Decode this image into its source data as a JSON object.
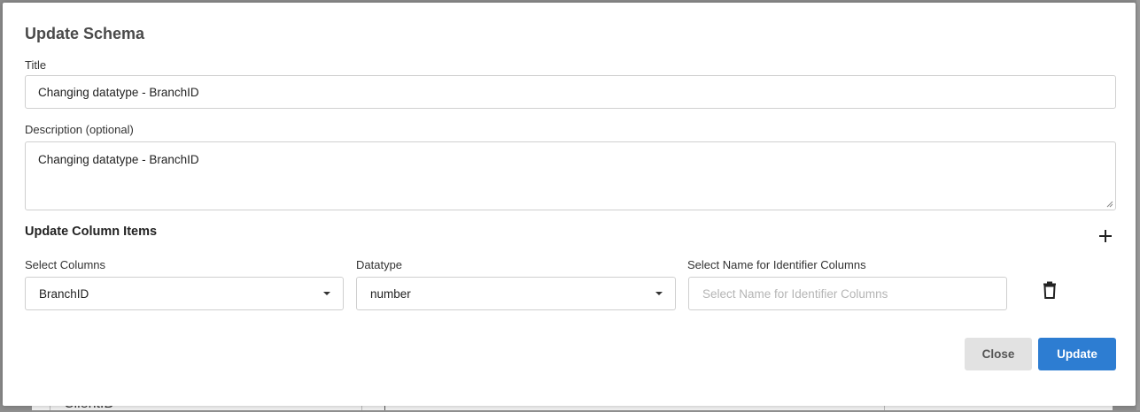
{
  "background": {
    "cell_text": "ClientID"
  },
  "dialog": {
    "title": "Update Schema",
    "title_label": "Title",
    "title_value": "Changing datatype - BranchID",
    "description_label": "Description (optional)",
    "description_value": "Changing datatype - BranchID",
    "section_title": "Update Column Items",
    "columns": {
      "select_columns_label": "Select Columns",
      "select_columns_value": "BranchID",
      "datatype_label": "Datatype",
      "datatype_value": "number",
      "identifier_label": "Select Name for Identifier Columns",
      "identifier_placeholder": "Select Name for Identifier Columns"
    },
    "close_label": "Close",
    "update_label": "Update"
  },
  "icons": {
    "add": "plus-icon",
    "delete": "trash-icon",
    "dropdown": "chevron-down-icon"
  },
  "colors": {
    "primary": "#2d7dd2",
    "secondary": "#e2e2e2"
  }
}
